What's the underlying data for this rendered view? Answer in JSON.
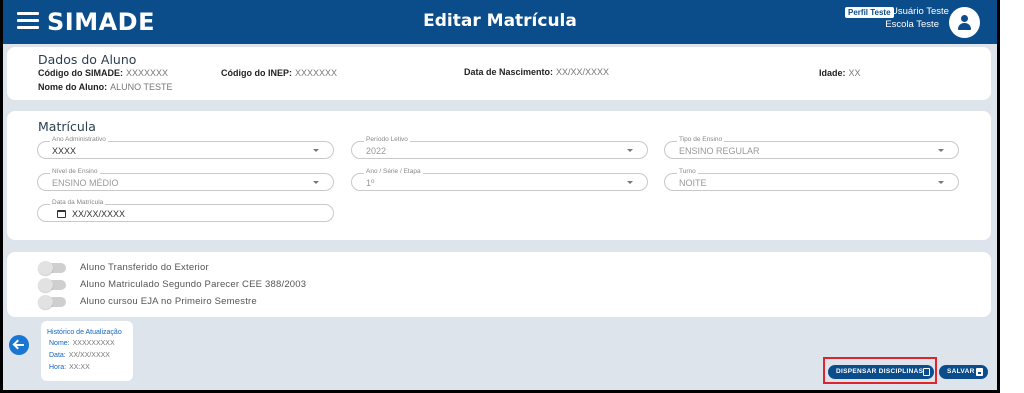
{
  "header": {
    "logo": "SIMADE",
    "title": "Editar Matrícula",
    "profile_badge": "Perfil Teste",
    "user_name": "Usuário Teste",
    "school_name": "Escola Teste"
  },
  "student": {
    "section_title": "Dados do Aluno",
    "simade_code_label": "Código do SIMADE:",
    "simade_code_value": "XXXXXXX",
    "inep_code_label": "Código do INEP:",
    "inep_code_value": "XXXXXXX",
    "birth_date_label": "Data de Nascimento:",
    "birth_date_value": "XX/XX/XXXX",
    "age_label": "Idade:",
    "age_value": "XX",
    "name_label": "Nome do Aluno:",
    "name_value": "ALUNO TESTE"
  },
  "enrollment": {
    "section_title": "Matrícula",
    "fields": [
      {
        "label": "Ano Administrativo",
        "value": "XXXX"
      },
      {
        "label": "Período Letivo",
        "value": "2022"
      },
      {
        "label": "Tipo de Ensino",
        "value": "ENSINO REGULAR"
      },
      {
        "label": "Nível de Ensino",
        "value": "ENSINO MÉDIO"
      },
      {
        "label": "Ano / Série / Etapa",
        "value": "1º"
      },
      {
        "label": "Turno",
        "value": "NOITE"
      },
      {
        "label": "Data da Matrícula",
        "value": "XX/XX/XXXX"
      }
    ]
  },
  "toggles": [
    {
      "label": "Aluno Transferido do Exterior",
      "checked": false
    },
    {
      "label": "Aluno Matriculado Segundo Parecer CEE 388/2003",
      "checked": false
    },
    {
      "label": "Aluno cursou EJA no Primeiro Semestre",
      "checked": false
    }
  ],
  "history": {
    "title": "Histórico de Atualização",
    "name_label": "Nome:",
    "name_value": "XXXXXXXXX",
    "date_label": "Data:",
    "date_value": "XX/XX/XXXX",
    "time_label": "Hora:",
    "time_value": "XX:XX"
  },
  "actions": {
    "dispense_label": "DISPENSAR DISCIPLINAS",
    "save_label": "SALVAR"
  },
  "colors": {
    "header_bg": "#0b4d8a",
    "page_bg": "#dde4ec",
    "accent_blue": "#1976d2",
    "highlight_red": "#e0242b"
  },
  "icons": [
    "menu-icon",
    "user-avatar-icon",
    "chevron-down-icon",
    "calendar-icon",
    "arrow-left-icon",
    "copy-icon",
    "save-icon"
  ]
}
